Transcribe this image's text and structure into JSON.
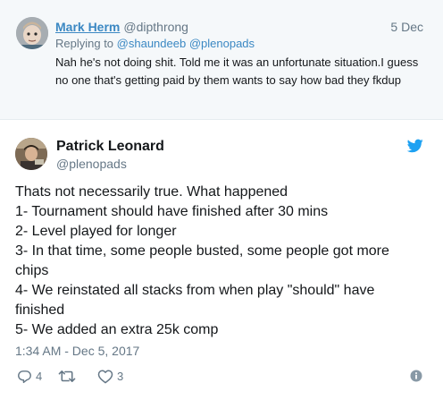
{
  "reply": {
    "name": "Mark Herm",
    "handle": "@dipthrong",
    "date": "5 Dec",
    "replying_prefix": "Replying to",
    "mentions": [
      "@shaundeeb",
      "@plenopads"
    ],
    "text": "Nah he's not doing shit. Told me it was an unfortunate situation.I guess no one that's getting paid by them wants to say how bad they fkdup"
  },
  "tweet": {
    "name": "Patrick Leonard",
    "handle": "@plenopads",
    "lines": [
      "Thats not necessarily true. What happened",
      "1- Tournament should have finished after 30 mins",
      "2- Level played for longer",
      "3- In that time, some people busted, some people got more",
      "chips",
      "4- We reinstated all stacks from when play \"should\" have",
      "finished",
      "5- We added an extra 25k comp"
    ],
    "timestamp": "1:34 AM - Dec 5, 2017",
    "reply_count": "4",
    "retweet_count": "",
    "like_count": "3"
  },
  "icons": {
    "bird": "twitter-bird-icon",
    "reply": "reply-icon",
    "retweet": "retweet-icon",
    "like": "heart-icon",
    "info": "info-icon"
  },
  "colors": {
    "link": "#3b88c3",
    "muted": "#657786",
    "twitter_blue": "#1da1f2",
    "reply_bg": "#f5f8fa"
  }
}
